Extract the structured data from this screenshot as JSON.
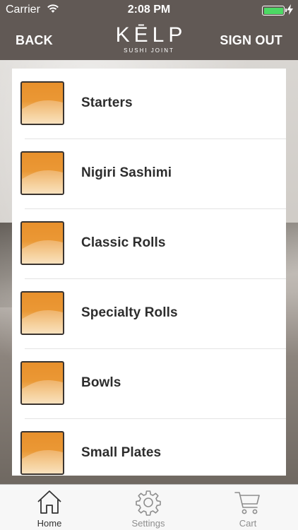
{
  "status_bar": {
    "carrier": "Carrier",
    "time": "2:08 PM"
  },
  "nav": {
    "back_label": "BACK",
    "logo_name": "KĒLP",
    "logo_sub": "SUSHI JOINT",
    "sign_out_label": "SIGN OUT"
  },
  "menu": {
    "items": [
      {
        "label": "Starters"
      },
      {
        "label": "Nigiri Sashimi"
      },
      {
        "label": "Classic Rolls"
      },
      {
        "label": "Specialty Rolls"
      },
      {
        "label": "Bowls"
      },
      {
        "label": "Small Plates"
      }
    ]
  },
  "tabs": [
    {
      "label": "Home",
      "icon": "home-icon",
      "active": true
    },
    {
      "label": "Settings",
      "icon": "gear-icon",
      "active": false
    },
    {
      "label": "Cart",
      "icon": "cart-icon",
      "active": false
    }
  ],
  "colors": {
    "header": "#615955",
    "thumb_orange": "#e8902c",
    "tab_active": "#333333",
    "tab_inactive": "#8e8e8e",
    "battery": "#4cd964"
  }
}
